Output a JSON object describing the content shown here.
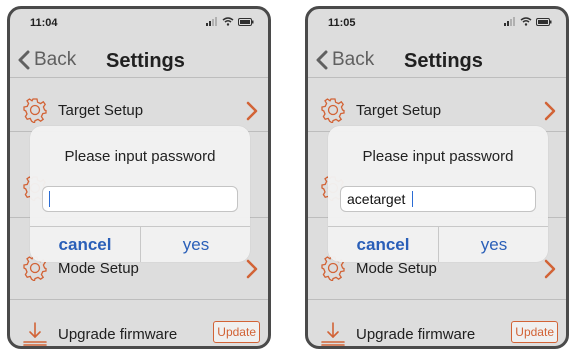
{
  "screens": [
    {
      "status": {
        "time": "11:04"
      },
      "nav": {
        "back_label": "Back",
        "title": "Settings"
      },
      "rows": {
        "target_setup": "Target Setup",
        "mode_setup": "Mode Setup",
        "upgrade_firmware": "Upgrade firmware",
        "update_button": "Update"
      },
      "dialog": {
        "message": "Please input password",
        "input_value": "",
        "cancel_label": "cancel",
        "yes_label": "yes"
      }
    },
    {
      "status": {
        "time": "11:05"
      },
      "nav": {
        "back_label": "Back",
        "title": "Settings"
      },
      "rows": {
        "target_setup": "Target Setup",
        "mode_setup": "Mode Setup",
        "upgrade_firmware": "Upgrade firmware",
        "update_button": "Update"
      },
      "dialog": {
        "message": "Please input password",
        "input_value": "acetarget",
        "cancel_label": "cancel",
        "yes_label": "yes"
      }
    }
  ],
  "icons": {
    "gear": "gear-icon",
    "chevron": "chevron-right-icon",
    "back": "chevron-left-icon",
    "upgrade": "download-tray-icon"
  },
  "colors": {
    "accent_orange": "#e06a3a",
    "dialog_button_blue": "#2a5fb8",
    "background_gray": "#ebebeb"
  }
}
